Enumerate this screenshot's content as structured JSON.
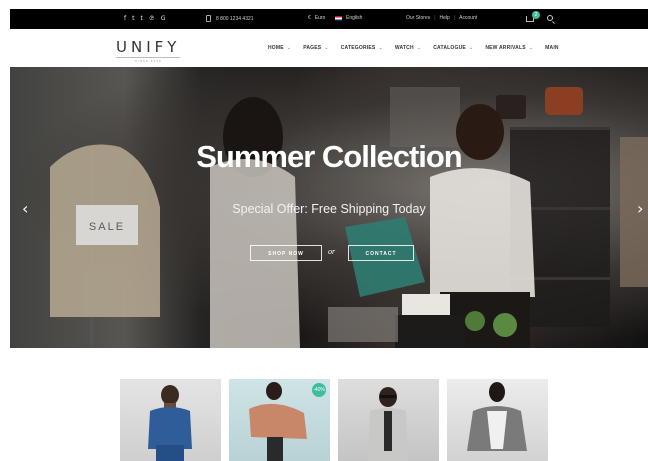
{
  "topbar": {
    "social_icons": [
      "facebook-icon",
      "twitter-icon",
      "tumblr-icon",
      "pinterest-icon",
      "google-plus-icon"
    ],
    "social_glyphs": [
      "f",
      "t",
      "t",
      "℗",
      "G"
    ],
    "phone": "8 800 1234 4321",
    "currency": "Euro",
    "currency_symbol": "€",
    "language": "English",
    "links": [
      "Our Stores",
      "Help",
      "Account"
    ],
    "cart_count": "2"
  },
  "logo": {
    "name": "UNIFY",
    "tagline": "SINCE 1990"
  },
  "menu": [
    {
      "label": "HOME",
      "chevron": "⌄"
    },
    {
      "label": "PAGES",
      "chevron": "⌄"
    },
    {
      "label": "CATEGORIES",
      "chevron": "⌄"
    },
    {
      "label": "WATCH",
      "chevron": "⌄"
    },
    {
      "label": "CATALOGUE",
      "chevron": "⌄"
    },
    {
      "label": "NEW ARRIVALS",
      "chevron": "⌄"
    },
    {
      "label": "MAIN",
      "chevron": ""
    }
  ],
  "hero": {
    "title": "Summer Collection",
    "subtitle": "Special Offer: Free Shipping Today",
    "shop_label": "SHOP NOW",
    "or_label": "or",
    "contact_label": "CONTACT",
    "sale_sign": "SALE",
    "prev_glyph": "‹",
    "next_glyph": "›"
  },
  "products": [
    {
      "badge": ""
    },
    {
      "badge": "-40%"
    },
    {
      "badge": ""
    },
    {
      "badge": ""
    }
  ],
  "colors": {
    "accent": "#3cbf9a",
    "topbar": "#000000"
  }
}
